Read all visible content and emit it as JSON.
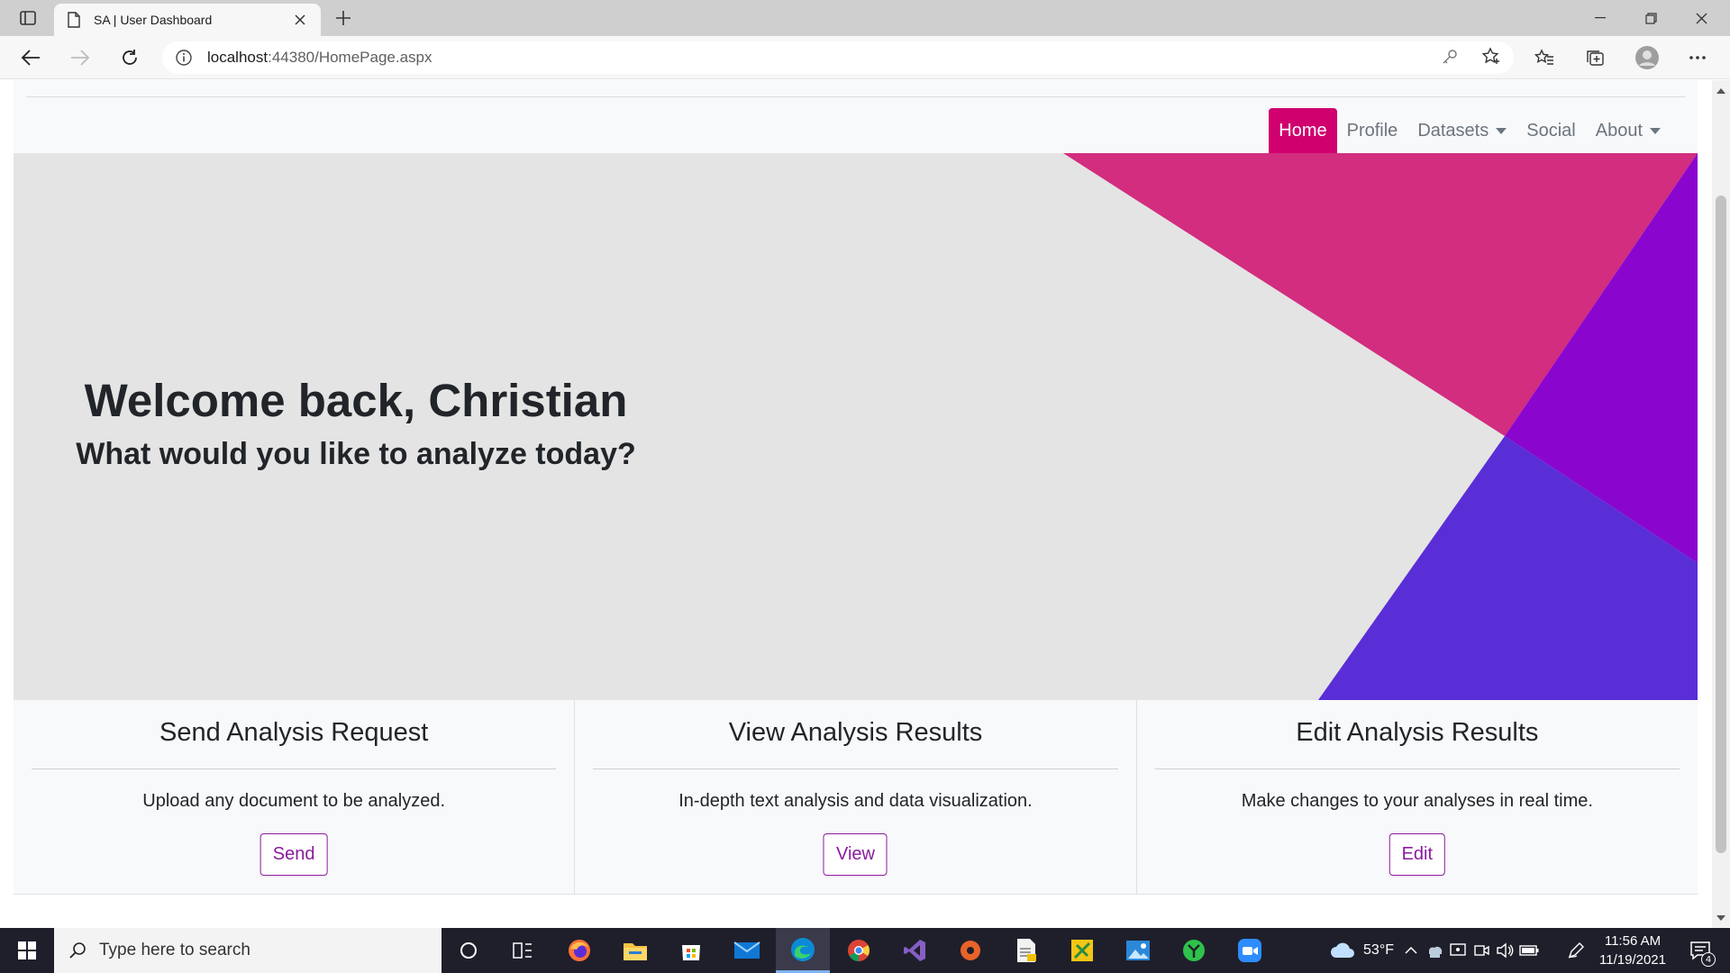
{
  "browser": {
    "tab_title": "SA | User Dashboard",
    "url_host": "localhost",
    "url_rest": ":44380/HomePage.aspx"
  },
  "site": {
    "nav": [
      {
        "label": "Home",
        "active": true
      },
      {
        "label": "Profile"
      },
      {
        "label": "Datasets",
        "dropdown": true
      },
      {
        "label": "Social"
      },
      {
        "label": "About",
        "dropdown": true
      }
    ],
    "hero": {
      "title": "Welcome back, Christian",
      "subtitle": "What would you like to analyze today?"
    },
    "cards": [
      {
        "title": "Send Analysis Request",
        "text": "Upload any document to be analyzed.",
        "button": "Send"
      },
      {
        "title": "View Analysis Results",
        "text": "In-depth text analysis and data visualization.",
        "button": "View"
      },
      {
        "title": "Edit Analysis Results",
        "text": "Make changes to your analyses in real time.",
        "button": "Edit"
      }
    ],
    "colors": {
      "active_nav": "#d0006f",
      "button_outline": "#8a1b9c",
      "shape_pink": "#d22d7f",
      "shape_purple": "#8a06cf",
      "shape_indigo": "#5a2ed6"
    }
  },
  "taskbar": {
    "search_placeholder": "Type here to search",
    "weather": "53°F",
    "time": "11:56 AM",
    "date": "11/19/2021",
    "notification_count": "4"
  }
}
